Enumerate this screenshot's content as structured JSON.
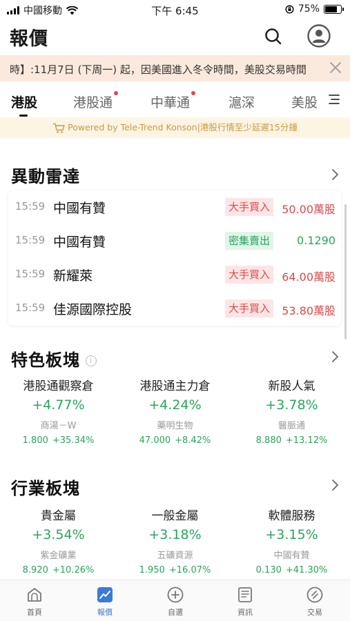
{
  "status_bar": {
    "carrier": "中國移動",
    "time": "下午 6:45",
    "battery_text": "75%",
    "battery_level": 0.75
  },
  "header": {
    "title": "報價",
    "search_icon": "search-icon",
    "avatar_icon": "user-avatar-icon"
  },
  "notice": {
    "text": "時】:11月7日 (下周一) 起，因美國進入冬令時間，美股交易時間",
    "close_icon": "close-icon"
  },
  "tabs": [
    {
      "label": "港股",
      "active": true,
      "dot": false
    },
    {
      "label": "港股通",
      "active": false,
      "dot": true
    },
    {
      "label": "中華通",
      "active": false,
      "dot": true
    },
    {
      "label": "滬深",
      "active": false,
      "dot": false
    },
    {
      "label": "美股",
      "active": false,
      "dot": false
    }
  ],
  "powered": {
    "text": "Powered by Tele-Trend Konson|港股行情至少延遲15分鐘",
    "icon": "cart-icon"
  },
  "radar": {
    "title": "異動雷達",
    "rows": [
      {
        "time": "15:59",
        "name": "中國有贊",
        "tag": "大手買入",
        "tag_type": "buy",
        "value": "50.00萬股"
      },
      {
        "time": "15:59",
        "name": "中國有贊",
        "tag": "密集賣出",
        "tag_type": "sell",
        "value": "0.1290"
      },
      {
        "time": "15:59",
        "name": "新耀萊",
        "tag": "大手買入",
        "tag_type": "buy",
        "value": "64.00萬股"
      },
      {
        "time": "15:59",
        "name": "佳源國際控股",
        "tag": "大手買入",
        "tag_type": "buy",
        "value": "53.80萬股"
      }
    ]
  },
  "featured": {
    "title": "特色板塊",
    "info_icon": "info-icon",
    "items": [
      {
        "name": "港股通觀察倉",
        "pct": "+4.77%",
        "stock": "商湯－W",
        "price": "1.800",
        "change": "+35.34%"
      },
      {
        "name": "港股通主力倉",
        "pct": "+4.24%",
        "stock": "藥明生物",
        "price": "47.000",
        "change": "+8.42%"
      },
      {
        "name": "新股人氣",
        "pct": "+3.78%",
        "stock": "醫脈通",
        "price": "8.880",
        "change": "+13.12%"
      }
    ]
  },
  "industry": {
    "title": "行業板塊",
    "items": [
      {
        "name": "貴金屬",
        "pct": "+3.54%",
        "stock": "紫金礦業",
        "price": "8.920",
        "change": "+10.26%"
      },
      {
        "name": "一般金屬",
        "pct": "+3.18%",
        "stock": "五礦資源",
        "price": "1.950",
        "change": "+16.07%"
      },
      {
        "name": "軟體服務",
        "pct": "+3.15%",
        "stock": "中國有贊",
        "price": "0.130",
        "change": "+41.30%"
      }
    ]
  },
  "bottom_nav": [
    {
      "label": "首頁",
      "icon": "home-icon",
      "active": false
    },
    {
      "label": "報價",
      "icon": "chart-icon",
      "active": true
    },
    {
      "label": "自選",
      "icon": "add-circle-icon",
      "active": false
    },
    {
      "label": "資訊",
      "icon": "news-icon",
      "active": false
    },
    {
      "label": "交易",
      "icon": "trade-icon",
      "active": false
    }
  ],
  "colors": {
    "up_green": "#2aa35c",
    "alert_red": "#d94a4a",
    "accent_blue": "#3a7bd5",
    "notice_bg": "#fbe9dd"
  }
}
